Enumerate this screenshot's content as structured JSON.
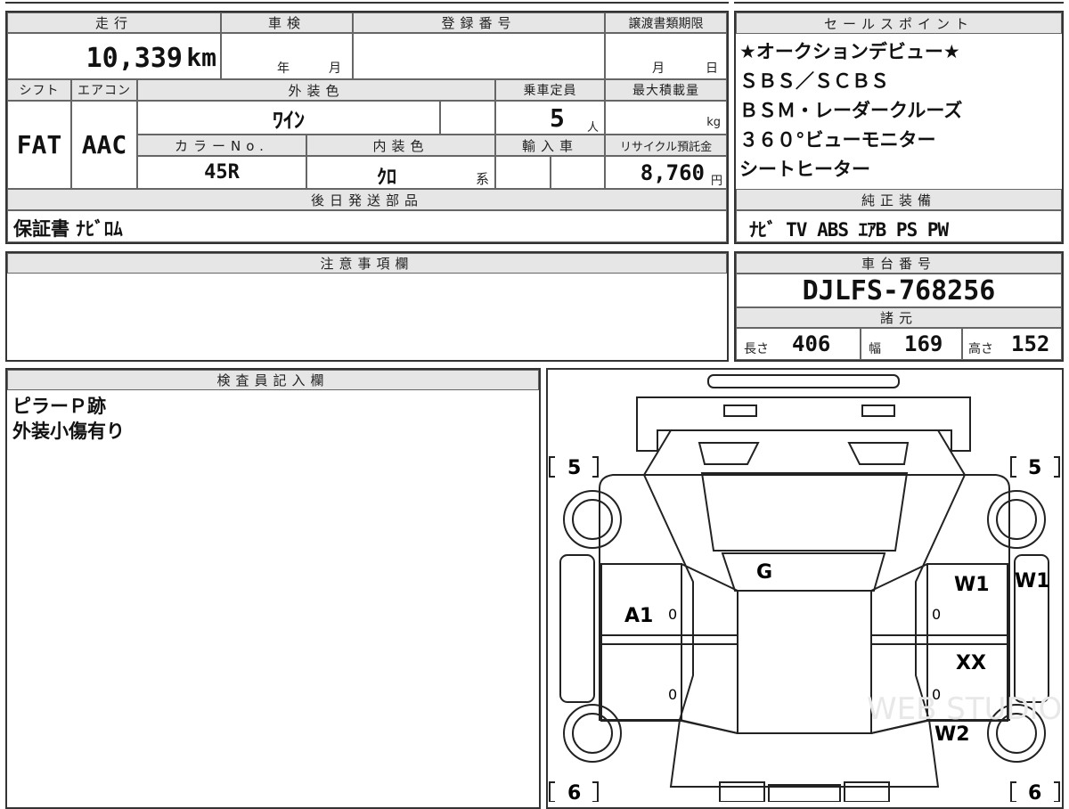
{
  "spec": {
    "mileage_label": "走行",
    "mileage_value": "10,339",
    "mileage_unit": "km",
    "inspection_label": "車検",
    "inspection_year": "年",
    "inspection_month": "月",
    "registration_label": "登録番号",
    "transfer_label": "譲渡書類期限",
    "transfer_month": "月",
    "transfer_day": "日",
    "shift_label": "シフト",
    "shift_value": "FAT",
    "ac_label": "エアコン",
    "ac_value": "AAC",
    "exterior_label": "外装色",
    "exterior_value": "ﾜｲﾝ",
    "capacity_label": "乗車定員",
    "capacity_value": "5",
    "capacity_unit": "人",
    "load_label": "最大積載量",
    "load_unit": "kg",
    "color_no_label": "カラーNo.",
    "color_no_value": "45R",
    "interior_label": "内装色",
    "interior_value": "ｸﾛ",
    "interior_unit": "系",
    "import_label": "輸入車",
    "recycle_label": "リサイクル預託金",
    "recycle_value": "8,760",
    "recycle_unit": "円",
    "later_parts_label": "後日発送部品",
    "later_parts_value": "保証書 ﾅﾋﾞﾛﾑ"
  },
  "sales_points": {
    "label": "セールスポイント",
    "lines": [
      "★オークションデビュー★",
      "ＳＢＳ／ＳＣＢＳ",
      "ＢＳＭ・レーダークルーズ",
      "３６０°ビューモニター",
      "シートヒーター"
    ]
  },
  "equipment": {
    "label": "純正装備",
    "value": "ﾅﾋﾞ TV ABS ｴｱB PS PW"
  },
  "caution": {
    "label": "注意事項欄"
  },
  "chassis": {
    "label": "車台番号",
    "value": "DJLFS-768256"
  },
  "dimensions": {
    "label": "諸元",
    "length_label": "長さ",
    "length_value": "406",
    "width_label": "幅",
    "width_value": "169",
    "height_label": "高さ",
    "height_value": "152"
  },
  "inspector": {
    "label": "検査員記入欄",
    "lines": [
      "ピラーＰ跡",
      "外装小傷有り"
    ]
  },
  "diagram": {
    "tire_fl": "5",
    "tire_fr": "5",
    "tire_rl": "6",
    "tire_rr": "6",
    "mark_windshield": "G",
    "mark_left_door": "A1",
    "mark_right_door_front": "W1",
    "mark_right_pillar": "W1",
    "mark_right_door_rear": "XX",
    "mark_right_quarter": "W2",
    "door_digit": "0",
    "watermark": "WEB STUDIO"
  }
}
